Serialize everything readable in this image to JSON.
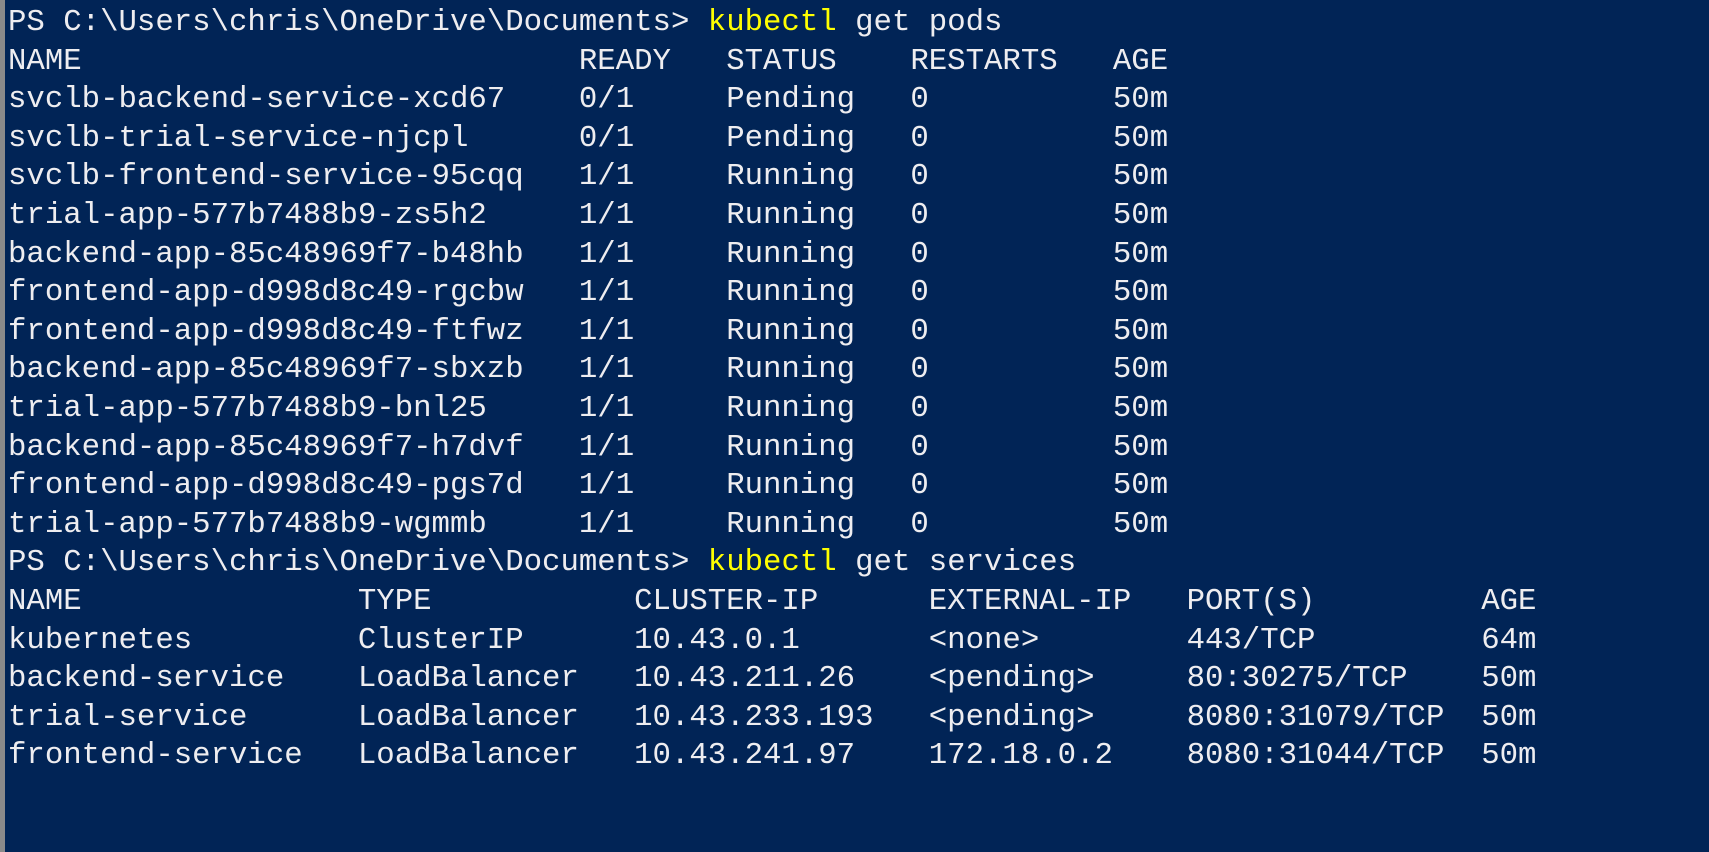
{
  "prompt": "PS C:\\Users\\chris\\OneDrive\\Documents> ",
  "commands": [
    {
      "cmd": "kubectl",
      "args": " get pods"
    },
    {
      "cmd": "kubectl",
      "args": " get services"
    }
  ],
  "pods": {
    "headers": [
      "NAME",
      "READY",
      "STATUS",
      "RESTARTS",
      "AGE"
    ],
    "rows": [
      [
        "svclb-backend-service-xcd67",
        "0/1",
        "Pending",
        "0",
        "50m"
      ],
      [
        "svclb-trial-service-njcpl",
        "0/1",
        "Pending",
        "0",
        "50m"
      ],
      [
        "svclb-frontend-service-95cqq",
        "1/1",
        "Running",
        "0",
        "50m"
      ],
      [
        "trial-app-577b7488b9-zs5h2",
        "1/1",
        "Running",
        "0",
        "50m"
      ],
      [
        "backend-app-85c48969f7-b48hb",
        "1/1",
        "Running",
        "0",
        "50m"
      ],
      [
        "frontend-app-d998d8c49-rgcbw",
        "1/1",
        "Running",
        "0",
        "50m"
      ],
      [
        "frontend-app-d998d8c49-ftfwz",
        "1/1",
        "Running",
        "0",
        "50m"
      ],
      [
        "backend-app-85c48969f7-sbxzb",
        "1/1",
        "Running",
        "0",
        "50m"
      ],
      [
        "trial-app-577b7488b9-bnl25",
        "1/1",
        "Running",
        "0",
        "50m"
      ],
      [
        "backend-app-85c48969f7-h7dvf",
        "1/1",
        "Running",
        "0",
        "50m"
      ],
      [
        "frontend-app-d998d8c49-pgs7d",
        "1/1",
        "Running",
        "0",
        "50m"
      ],
      [
        "trial-app-577b7488b9-wgmmb",
        "1/1",
        "Running",
        "0",
        "50m"
      ]
    ]
  },
  "services": {
    "headers": [
      "NAME",
      "TYPE",
      "CLUSTER-IP",
      "EXTERNAL-IP",
      "PORT(S)",
      "AGE"
    ],
    "rows": [
      [
        "kubernetes",
        "ClusterIP",
        "10.43.0.1",
        "<none>",
        "443/TCP",
        "64m"
      ],
      [
        "backend-service",
        "LoadBalancer",
        "10.43.211.26",
        "<pending>",
        "80:30275/TCP",
        "50m"
      ],
      [
        "trial-service",
        "LoadBalancer",
        "10.43.233.193",
        "<pending>",
        "8080:31079/TCP",
        "50m"
      ],
      [
        "frontend-service",
        "LoadBalancer",
        "10.43.241.97",
        "172.18.0.2",
        "8080:31044/TCP",
        "50m"
      ]
    ]
  }
}
